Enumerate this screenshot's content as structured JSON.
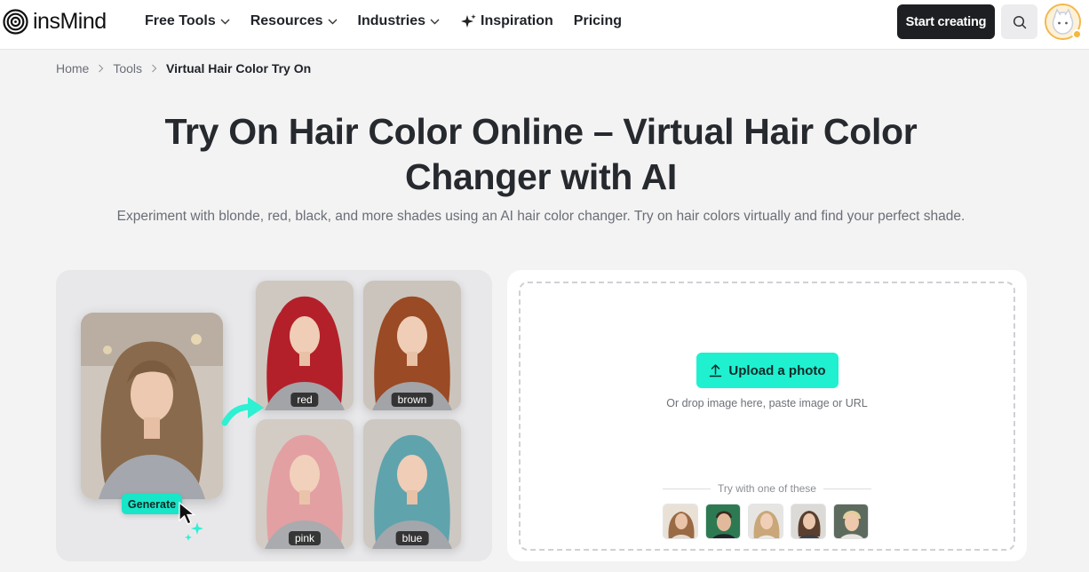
{
  "header": {
    "logo_text": "insMind",
    "nav": [
      {
        "label": "Free Tools",
        "has_dropdown": true
      },
      {
        "label": "Resources",
        "has_dropdown": true
      },
      {
        "label": "Industries",
        "has_dropdown": true
      },
      {
        "label": "Inspiration",
        "has_dropdown": false,
        "icon": "sparkle-icon"
      },
      {
        "label": "Pricing",
        "has_dropdown": false
      }
    ],
    "start_button": "Start creating",
    "search_icon": "search-icon"
  },
  "breadcrumb": {
    "items": [
      "Home",
      "Tools"
    ],
    "current": "Virtual Hair Color Try On"
  },
  "hero": {
    "title": "Try On Hair Color Online – Virtual Hair Color Changer with AI",
    "subtitle": "Experiment with blonde, red, black, and more shades using an AI hair color changer. Try on hair colors virtually and find your perfect shade."
  },
  "showcase": {
    "generate_label": "Generate",
    "variants": [
      {
        "label": "red",
        "hair_color": "#b3202a"
      },
      {
        "label": "brown",
        "hair_color": "#9a4a24"
      },
      {
        "label": "pink",
        "hair_color": "#e3a0a2"
      },
      {
        "label": "blue",
        "hair_color": "#5fa3ad"
      }
    ],
    "original_hair_color": "#8a6a4c"
  },
  "upload": {
    "button_label": "Upload a photo",
    "drop_hint": "Or drop image here, paste image or URL",
    "try_label": "Try with one of these",
    "sample_count": 5
  },
  "colors": {
    "accent": "#1ff0d0",
    "dark_button": "#1d1f22"
  }
}
